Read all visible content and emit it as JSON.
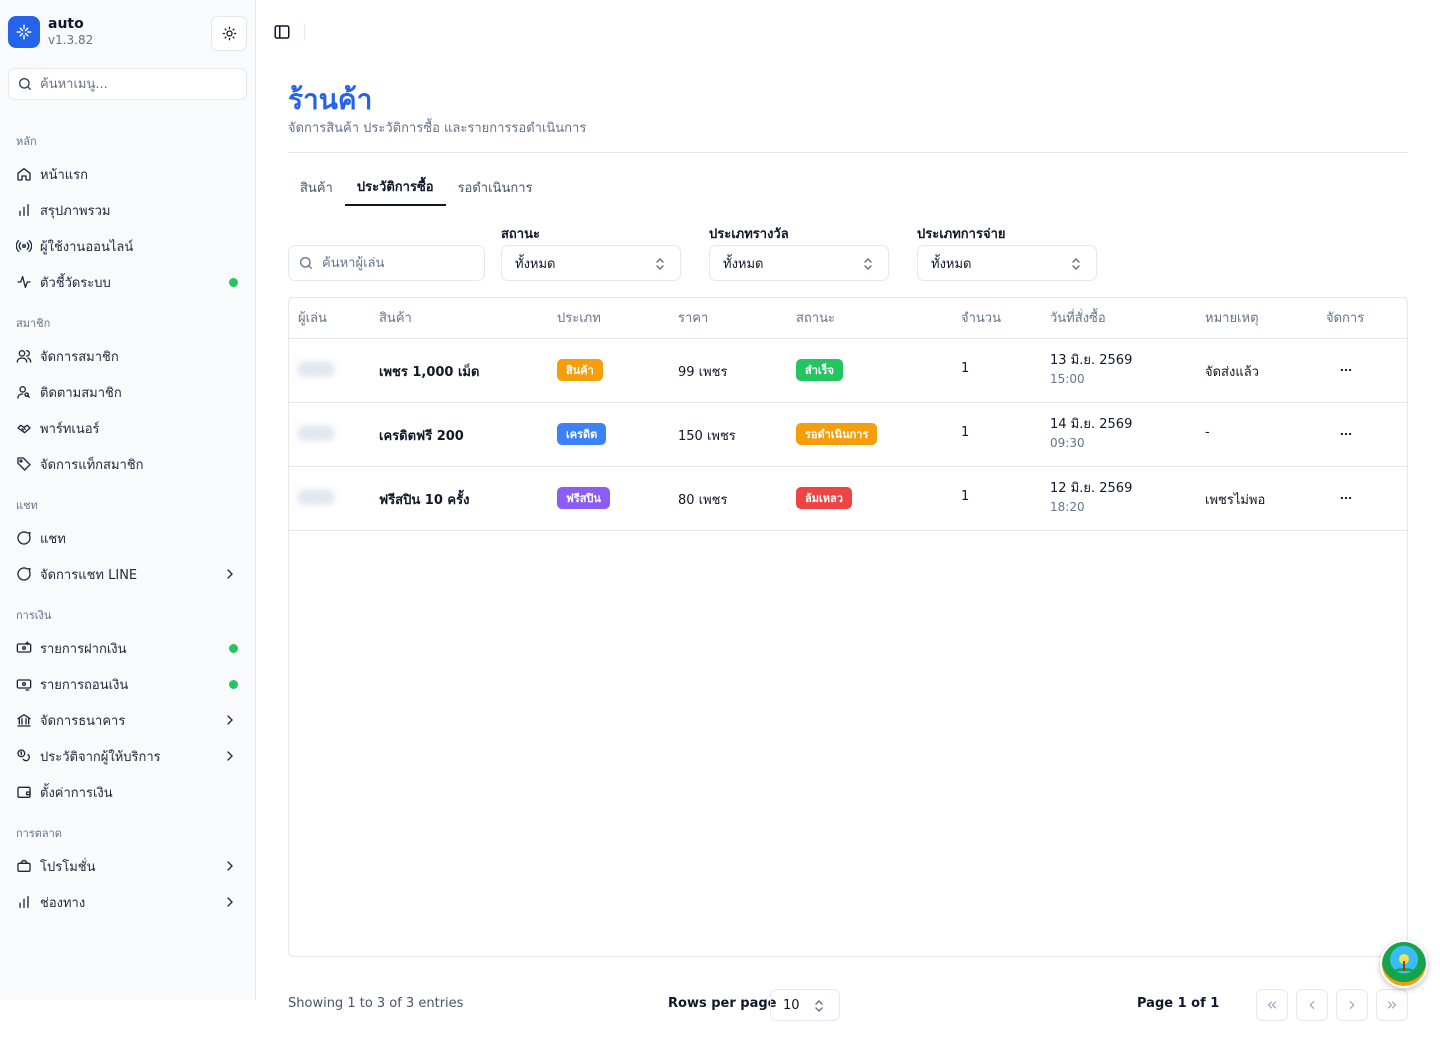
{
  "brand": {
    "name": "auto",
    "version": "v1.3.82"
  },
  "sidebar": {
    "search_placeholder": "ค้นหาเมนู...",
    "groups": [
      {
        "label": "หลัก",
        "items": [
          {
            "label": "หน้าแรก",
            "icon": "home-icon"
          },
          {
            "label": "สรุปภาพรวม",
            "icon": "bar-chart-icon"
          },
          {
            "label": "ผู้ใช้งานออนไลน์",
            "icon": "radio-icon"
          },
          {
            "label": "ตัวชี้วัดระบบ",
            "icon": "activity-icon",
            "indicator": true
          }
        ]
      },
      {
        "label": "สมาชิก",
        "items": [
          {
            "label": "จัดการสมาชิก",
            "icon": "users-icon"
          },
          {
            "label": "ติดตามสมาชิก",
            "icon": "user-search-icon"
          },
          {
            "label": "พาร์ทเนอร์",
            "icon": "handshake-icon"
          },
          {
            "label": "จัดการแท็กสมาชิก",
            "icon": "tag-icon"
          }
        ]
      },
      {
        "label": "แชท",
        "items": [
          {
            "label": "แชท",
            "icon": "chat-icon"
          },
          {
            "label": "จัดการแชท LINE",
            "icon": "chat-icon",
            "expandable": true
          }
        ]
      },
      {
        "label": "การเงิน",
        "items": [
          {
            "label": "รายการฝากเงิน",
            "icon": "deposit-icon",
            "indicator": true
          },
          {
            "label": "รายการถอนเงิน",
            "icon": "withdraw-icon",
            "indicator": true
          },
          {
            "label": "จัดการธนาคาร",
            "icon": "bank-icon",
            "expandable": true
          },
          {
            "label": "ประวัติจากผู้ให้บริการ",
            "icon": "coins-icon",
            "expandable": true
          },
          {
            "label": "ตั้งค่าการเงิน",
            "icon": "wallet-icon"
          }
        ]
      },
      {
        "label": "การตลาด",
        "items": [
          {
            "label": "โปรโมชั่น",
            "icon": "promo-icon",
            "expandable": true
          },
          {
            "label": "ช่องทาง",
            "icon": "bar-chart-icon",
            "expandable": true
          }
        ]
      }
    ]
  },
  "page": {
    "title": "ร้านค้า",
    "subtitle": "จัดการสินค้า ประวัติการซื้อ และรายการรอดำเนินการ"
  },
  "tabs": [
    {
      "label": "สินค้า",
      "active": false
    },
    {
      "label": "ประวัติการซื้อ",
      "active": true
    },
    {
      "label": "รอดำเนินการ",
      "active": false
    }
  ],
  "filters": {
    "search_placeholder": "ค้นหาผู้เล่น",
    "status": {
      "label": "สถานะ",
      "value": "ทั้งหมด"
    },
    "reward_type": {
      "label": "ประเภทรางวัล",
      "value": "ทั้งหมด"
    },
    "payment_type": {
      "label": "ประเภทการจ่าย",
      "value": "ทั้งหมด"
    }
  },
  "table": {
    "columns": [
      "ผู้เล่น",
      "สินค้า",
      "ประเภท",
      "ราคา",
      "สถานะ",
      "จำนวน",
      "วันที่สั่งซื้อ",
      "หมายเหตุ",
      "จัดการ"
    ],
    "rows": [
      {
        "product": "เพชร 1,000 เม็ด",
        "type": "สินค้า",
        "type_color": "#f59e0b",
        "price": "99 เพชร",
        "status": "สำเร็จ",
        "status_color": "#22c55e",
        "qty": "1",
        "date": "13 มิ.ย. 2569",
        "time": "15:00",
        "note": "จัดส่งแล้ว"
      },
      {
        "product": "เครดิตฟรี 200",
        "type": "เครดิต",
        "type_color": "#3b82f6",
        "price": "150 เพชร",
        "status": "รอดำเนินการ",
        "status_color": "#f59e0b",
        "qty": "1",
        "date": "14 มิ.ย. 2569",
        "time": "09:30",
        "note": "-"
      },
      {
        "product": "ฟรีสปิน 10 ครั้ง",
        "type": "ฟรีสปิน",
        "type_color": "#8b5cf6",
        "price": "80 เพชร",
        "status": "ล้มเหลว",
        "status_color": "#ef4444",
        "qty": "1",
        "date": "12 มิ.ย. 2569",
        "time": "18:20",
        "note": "เพชรไม่พอ"
      }
    ]
  },
  "pagination": {
    "info": "Showing 1 to 3 of 3 entries",
    "rows_per_page_label": "Rows per page",
    "rows_per_page": "10",
    "page_label": "Page 1 of 1"
  },
  "colors": {
    "accent": "#2563eb",
    "indicator": "#22c55e"
  }
}
